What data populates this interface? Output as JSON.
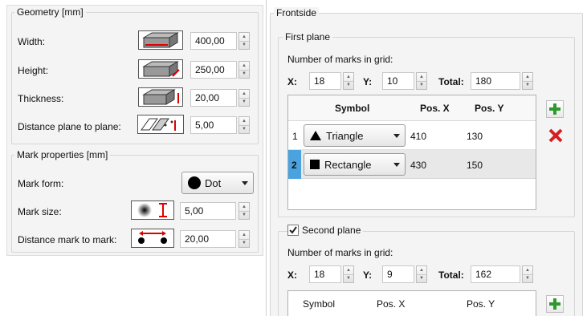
{
  "geometry": {
    "title": "Geometry [mm]",
    "width": {
      "label": "Width:",
      "value": "400,00"
    },
    "height": {
      "label": "Height:",
      "value": "250,00"
    },
    "thickness": {
      "label": "Thickness:",
      "value": "20,00"
    },
    "distance_plane": {
      "label": "Distance plane to plane:",
      "value": "5,00"
    }
  },
  "mark_properties": {
    "title": "Mark properties [mm]",
    "mark_form": {
      "label": "Mark form:",
      "value": "Dot"
    },
    "mark_size": {
      "label": "Mark size:",
      "value": "5,00"
    },
    "distance_mark": {
      "label": "Distance mark to mark:",
      "value": "20,00"
    }
  },
  "frontside": {
    "title": "Frontside",
    "first_plane": {
      "title": "First plane",
      "grid_label": "Number of marks in grid:",
      "x_label": "X:",
      "x_value": "18",
      "y_label": "Y:",
      "y_value": "10",
      "total_label": "Total:",
      "total_value": "180",
      "columns": [
        "Symbol",
        "Pos. X",
        "Pos. Y"
      ],
      "rows": [
        {
          "index": "1",
          "symbol": "Triangle",
          "pos_x": "410",
          "pos_y": "130"
        },
        {
          "index": "2",
          "symbol": "Rectangle",
          "pos_x": "430",
          "pos_y": "150"
        }
      ]
    },
    "second_plane": {
      "checkbox_label": "Second plane",
      "checked": true,
      "grid_label": "Number of marks in grid:",
      "x_label": "X:",
      "x_value": "18",
      "y_label": "Y:",
      "y_value": "9",
      "total_label": "Total:",
      "total_value": "162",
      "columns": [
        "Symbol",
        "Pos. X",
        "Pos. Y"
      ]
    }
  },
  "colors": {
    "add": "#2e9a2e",
    "delete": "#d42020",
    "selected_index": "#4aa3df"
  },
  "icons": [
    "plate-width-icon",
    "plate-height-icon",
    "plate-thickness-icon",
    "plane-distance-icon",
    "mark-size-icon",
    "mark-distance-icon",
    "plus-icon",
    "delete-x-icon",
    "checkmark-icon"
  ]
}
